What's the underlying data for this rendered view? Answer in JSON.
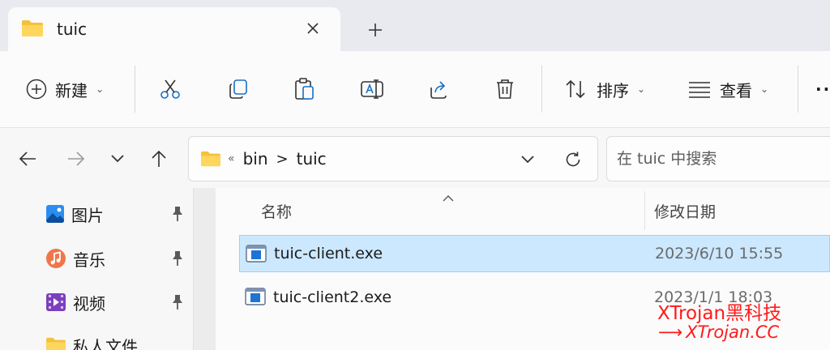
{
  "tab": {
    "title": "tuic"
  },
  "toolbar": {
    "new_label": "新建",
    "sort_label": "排序",
    "view_label": "查看",
    "more_label": "···"
  },
  "address": {
    "overflow": "«",
    "crumbs": [
      "bin",
      "tuic"
    ],
    "separator": ">"
  },
  "search": {
    "placeholder": "在 tuic 中搜索"
  },
  "sidebar": {
    "items": [
      {
        "label": "图片",
        "icon": "pictures-icon"
      },
      {
        "label": "音乐",
        "icon": "music-icon"
      },
      {
        "label": "视频",
        "icon": "videos-icon"
      },
      {
        "label": "私人文件",
        "icon": "folder-icon"
      }
    ]
  },
  "columns": {
    "name": "名称",
    "date": "修改日期"
  },
  "files": [
    {
      "name": "tuic-client.exe",
      "date": "2023/6/10 15:55",
      "selected": true
    },
    {
      "name": "tuic-client2.exe",
      "date": "2023/1/1 18:03",
      "selected": false
    }
  ],
  "watermark": {
    "line1": "XTrojan黑科技",
    "line2": "XTrojan.CC",
    "arrow": "⟶"
  },
  "colors": {
    "accent": "#0067c0",
    "selection": "#cce8ff",
    "folder": "#f5c13b",
    "watermark": "#ff1a1a"
  }
}
